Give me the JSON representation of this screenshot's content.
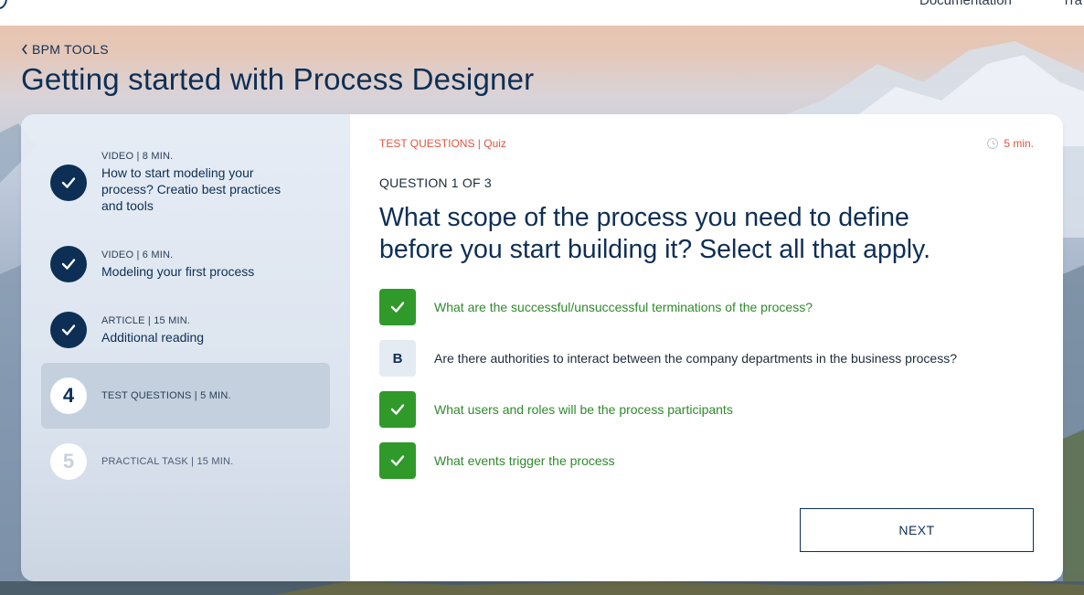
{
  "topbar": {
    "nav_documentation": "Documentation",
    "nav_training": "Tra"
  },
  "breadcrumb": {
    "chevron_icon": "chevron-left-icon",
    "label": "BPM TOOLS"
  },
  "page_title": "Getting started with Process Designer",
  "sidebar": {
    "steps": [
      {
        "status": "done",
        "icon": "checkmark-icon",
        "meta": "VIDEO | 8 MIN.",
        "title_line1": "How to start modeling your",
        "title_line2": "process? Creatio best practices",
        "title_line3": "and tools"
      },
      {
        "status": "done",
        "icon": "checkmark-icon",
        "meta": "VIDEO | 6 MIN.",
        "title_line1": "Modeling your first process"
      },
      {
        "status": "done",
        "icon": "checkmark-icon",
        "meta": "ARTICLE | 15 MIN.",
        "title_line1": "Additional reading"
      },
      {
        "status": "current",
        "number": "4",
        "meta": "TEST QUESTIONS | 5 MIN."
      },
      {
        "status": "pending",
        "number": "5",
        "meta": "PRACTICAL TASK | 15 MIN."
      }
    ]
  },
  "main": {
    "type_line": "TEST QUESTIONS | Quiz",
    "duration": "5 min.",
    "question_number": "QUESTION 1 OF 3",
    "question_line1": "What scope of the process you need to define",
    "question_line2": "before you start building it? Select all that apply.",
    "answers": [
      {
        "state": "checked",
        "icon": "checkmark-icon",
        "text": "What are the successful/unsuccessful terminations of the process?"
      },
      {
        "state": "unchecked",
        "letter": "B",
        "text": "Are there authorities to interact between the company departments in the business process?"
      },
      {
        "state": "checked",
        "icon": "checkmark-icon",
        "text": "What users and roles will be the process participants"
      },
      {
        "state": "checked",
        "icon": "checkmark-icon",
        "text": "What events trigger the process"
      }
    ],
    "next_label": "NEXT"
  },
  "colors": {
    "brand_navy": "#0d2f55",
    "correct_green": "#2f9a2a",
    "accent_red": "#e0553f",
    "active_step_bg": "#c4d0de"
  }
}
